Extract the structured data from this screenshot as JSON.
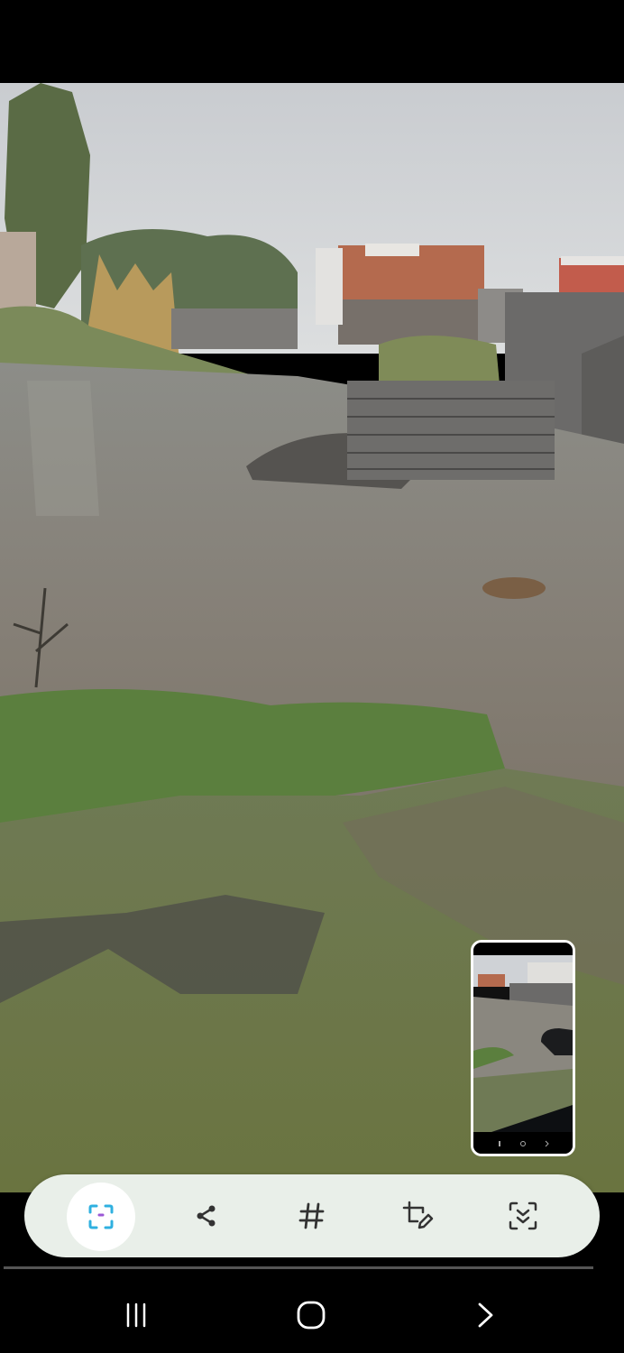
{
  "toolbar": {
    "buttons": [
      {
        "name": "capture-more",
        "icon": "scroll-capture-icon",
        "active": true
      },
      {
        "name": "share",
        "icon": "share-icon"
      },
      {
        "name": "tags",
        "icon": "hashtag-icon"
      },
      {
        "name": "edit",
        "icon": "crop-edit-icon"
      },
      {
        "name": "extract",
        "icon": "text-extract-icon"
      }
    ],
    "accent_color": "#2fb0e0"
  },
  "nav": {
    "buttons": [
      "recent-apps-icon",
      "home-icon",
      "back-icon"
    ]
  },
  "preview": {
    "description_icon": "screenshot-thumbnail"
  }
}
